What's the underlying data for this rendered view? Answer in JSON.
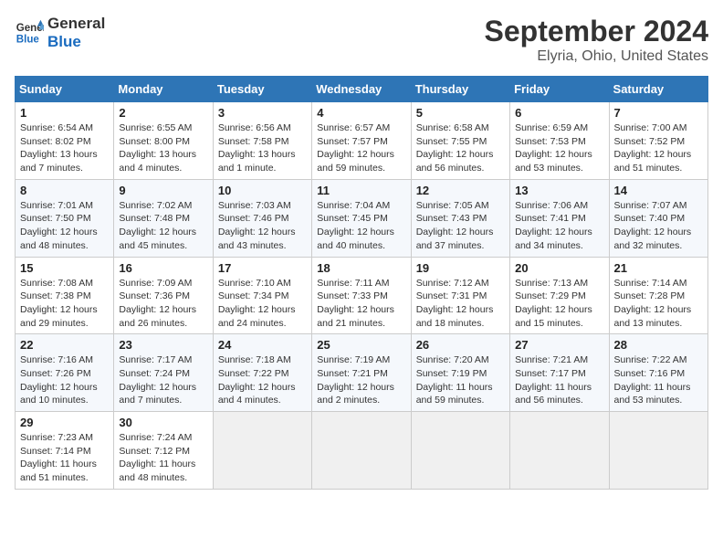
{
  "header": {
    "logo_line1": "General",
    "logo_line2": "Blue",
    "month_year": "September 2024",
    "location": "Elyria, Ohio, United States"
  },
  "calendar": {
    "days_of_week": [
      "Sunday",
      "Monday",
      "Tuesday",
      "Wednesday",
      "Thursday",
      "Friday",
      "Saturday"
    ],
    "weeks": [
      [
        {
          "day": "1",
          "info": "Sunrise: 6:54 AM\nSunset: 8:02 PM\nDaylight: 13 hours and 7 minutes."
        },
        {
          "day": "2",
          "info": "Sunrise: 6:55 AM\nSunset: 8:00 PM\nDaylight: 13 hours and 4 minutes."
        },
        {
          "day": "3",
          "info": "Sunrise: 6:56 AM\nSunset: 7:58 PM\nDaylight: 13 hours and 1 minute."
        },
        {
          "day": "4",
          "info": "Sunrise: 6:57 AM\nSunset: 7:57 PM\nDaylight: 12 hours and 59 minutes."
        },
        {
          "day": "5",
          "info": "Sunrise: 6:58 AM\nSunset: 7:55 PM\nDaylight: 12 hours and 56 minutes."
        },
        {
          "day": "6",
          "info": "Sunrise: 6:59 AM\nSunset: 7:53 PM\nDaylight: 12 hours and 53 minutes."
        },
        {
          "day": "7",
          "info": "Sunrise: 7:00 AM\nSunset: 7:52 PM\nDaylight: 12 hours and 51 minutes."
        }
      ],
      [
        {
          "day": "8",
          "info": "Sunrise: 7:01 AM\nSunset: 7:50 PM\nDaylight: 12 hours and 48 minutes."
        },
        {
          "day": "9",
          "info": "Sunrise: 7:02 AM\nSunset: 7:48 PM\nDaylight: 12 hours and 45 minutes."
        },
        {
          "day": "10",
          "info": "Sunrise: 7:03 AM\nSunset: 7:46 PM\nDaylight: 12 hours and 43 minutes."
        },
        {
          "day": "11",
          "info": "Sunrise: 7:04 AM\nSunset: 7:45 PM\nDaylight: 12 hours and 40 minutes."
        },
        {
          "day": "12",
          "info": "Sunrise: 7:05 AM\nSunset: 7:43 PM\nDaylight: 12 hours and 37 minutes."
        },
        {
          "day": "13",
          "info": "Sunrise: 7:06 AM\nSunset: 7:41 PM\nDaylight: 12 hours and 34 minutes."
        },
        {
          "day": "14",
          "info": "Sunrise: 7:07 AM\nSunset: 7:40 PM\nDaylight: 12 hours and 32 minutes."
        }
      ],
      [
        {
          "day": "15",
          "info": "Sunrise: 7:08 AM\nSunset: 7:38 PM\nDaylight: 12 hours and 29 minutes."
        },
        {
          "day": "16",
          "info": "Sunrise: 7:09 AM\nSunset: 7:36 PM\nDaylight: 12 hours and 26 minutes."
        },
        {
          "day": "17",
          "info": "Sunrise: 7:10 AM\nSunset: 7:34 PM\nDaylight: 12 hours and 24 minutes."
        },
        {
          "day": "18",
          "info": "Sunrise: 7:11 AM\nSunset: 7:33 PM\nDaylight: 12 hours and 21 minutes."
        },
        {
          "day": "19",
          "info": "Sunrise: 7:12 AM\nSunset: 7:31 PM\nDaylight: 12 hours and 18 minutes."
        },
        {
          "day": "20",
          "info": "Sunrise: 7:13 AM\nSunset: 7:29 PM\nDaylight: 12 hours and 15 minutes."
        },
        {
          "day": "21",
          "info": "Sunrise: 7:14 AM\nSunset: 7:28 PM\nDaylight: 12 hours and 13 minutes."
        }
      ],
      [
        {
          "day": "22",
          "info": "Sunrise: 7:16 AM\nSunset: 7:26 PM\nDaylight: 12 hours and 10 minutes."
        },
        {
          "day": "23",
          "info": "Sunrise: 7:17 AM\nSunset: 7:24 PM\nDaylight: 12 hours and 7 minutes."
        },
        {
          "day": "24",
          "info": "Sunrise: 7:18 AM\nSunset: 7:22 PM\nDaylight: 12 hours and 4 minutes."
        },
        {
          "day": "25",
          "info": "Sunrise: 7:19 AM\nSunset: 7:21 PM\nDaylight: 12 hours and 2 minutes."
        },
        {
          "day": "26",
          "info": "Sunrise: 7:20 AM\nSunset: 7:19 PM\nDaylight: 11 hours and 59 minutes."
        },
        {
          "day": "27",
          "info": "Sunrise: 7:21 AM\nSunset: 7:17 PM\nDaylight: 11 hours and 56 minutes."
        },
        {
          "day": "28",
          "info": "Sunrise: 7:22 AM\nSunset: 7:16 PM\nDaylight: 11 hours and 53 minutes."
        }
      ],
      [
        {
          "day": "29",
          "info": "Sunrise: 7:23 AM\nSunset: 7:14 PM\nDaylight: 11 hours and 51 minutes."
        },
        {
          "day": "30",
          "info": "Sunrise: 7:24 AM\nSunset: 7:12 PM\nDaylight: 11 hours and 48 minutes."
        },
        null,
        null,
        null,
        null,
        null
      ]
    ]
  }
}
